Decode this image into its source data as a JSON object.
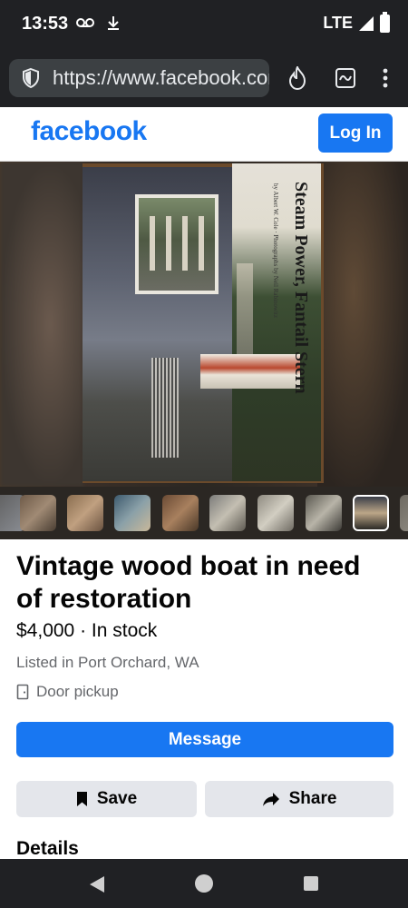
{
  "status_bar": {
    "time": "13:53",
    "network": "LTE"
  },
  "browser": {
    "url": "https://www.facebook.com/marketplace"
  },
  "header": {
    "logo_text": "facebook",
    "login_label": "Log In"
  },
  "listing": {
    "magazine_title": "Steam Power, Fantail Stern",
    "magazine_byline": "by Albert W. Cole · Photographs by Neil Rabinowitz",
    "title": "Vintage wood boat in need of restoration",
    "price_line": "$4,000 · In stock",
    "location": "Listed in Port Orchard, WA",
    "delivery": "Door pickup",
    "message_label": "Message",
    "save_label": "Save",
    "share_label": "Share",
    "details_heading": "Details"
  },
  "thumbnails": {
    "count": 9,
    "selected_index": 7
  },
  "colors": {
    "brand": "#1877f2",
    "secondary_button": "#e4e6eb",
    "system_bar": "#202124"
  }
}
